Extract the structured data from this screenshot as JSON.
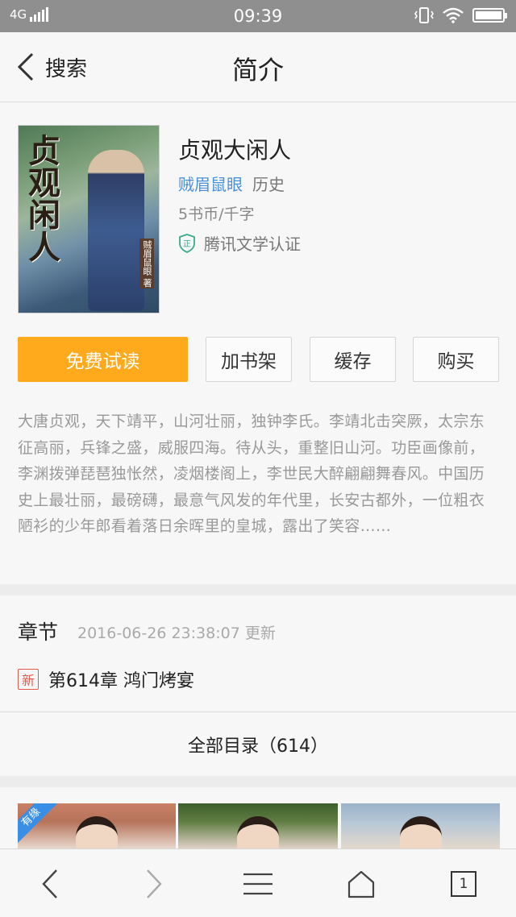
{
  "status_bar": {
    "network": "4G",
    "time": "09:39",
    "icons": [
      "signal-icon",
      "vibrate-icon",
      "wifi-icon",
      "battery-icon"
    ]
  },
  "header": {
    "back_label": "搜索",
    "title": "简介"
  },
  "book": {
    "cover_title": "贞观闲人",
    "cover_author": "贼眉鼠眼 著",
    "title": "贞观大闲人",
    "author": "贼眉鼠眼",
    "genre": "历史",
    "price": "5书币/千字",
    "certification": "腾讯文学认证",
    "cert_icon_char": "正"
  },
  "actions": {
    "read_free": "免费试读",
    "add_shelf": "加书架",
    "cache": "缓存",
    "buy": "购买"
  },
  "synopsis": "大唐贞观，天下靖平，山河壮丽，独钟李氏。李靖北击突厥，太宗东征高丽，兵锋之盛，威服四海。待从头，重整旧山河。功臣画像前，李渊拨弹琵琶独怅然，凌烟楼阁上，李世民大醉翩翩舞春风。中国历史上最壮丽，最磅礴，最意气风发的年代里，长安古都外，一位粗衣陋衫的少年郎看着落日余晖里的皇城，露出了笑容……",
  "chapters": {
    "heading": "章节",
    "updated": "2016-06-26 23:38:07 更新",
    "new_badge": "新",
    "latest": "第614章 鸿门烤宴",
    "all_toc": "全部目录（614）"
  },
  "ads": {
    "ribbon": "有缘"
  },
  "toolbar": {
    "tab_count": "1"
  },
  "colors": {
    "accent": "#ffaa1c",
    "link": "#4a90d9",
    "new_badge": "#e65a4b",
    "status_bar": "#8f8f8f"
  }
}
